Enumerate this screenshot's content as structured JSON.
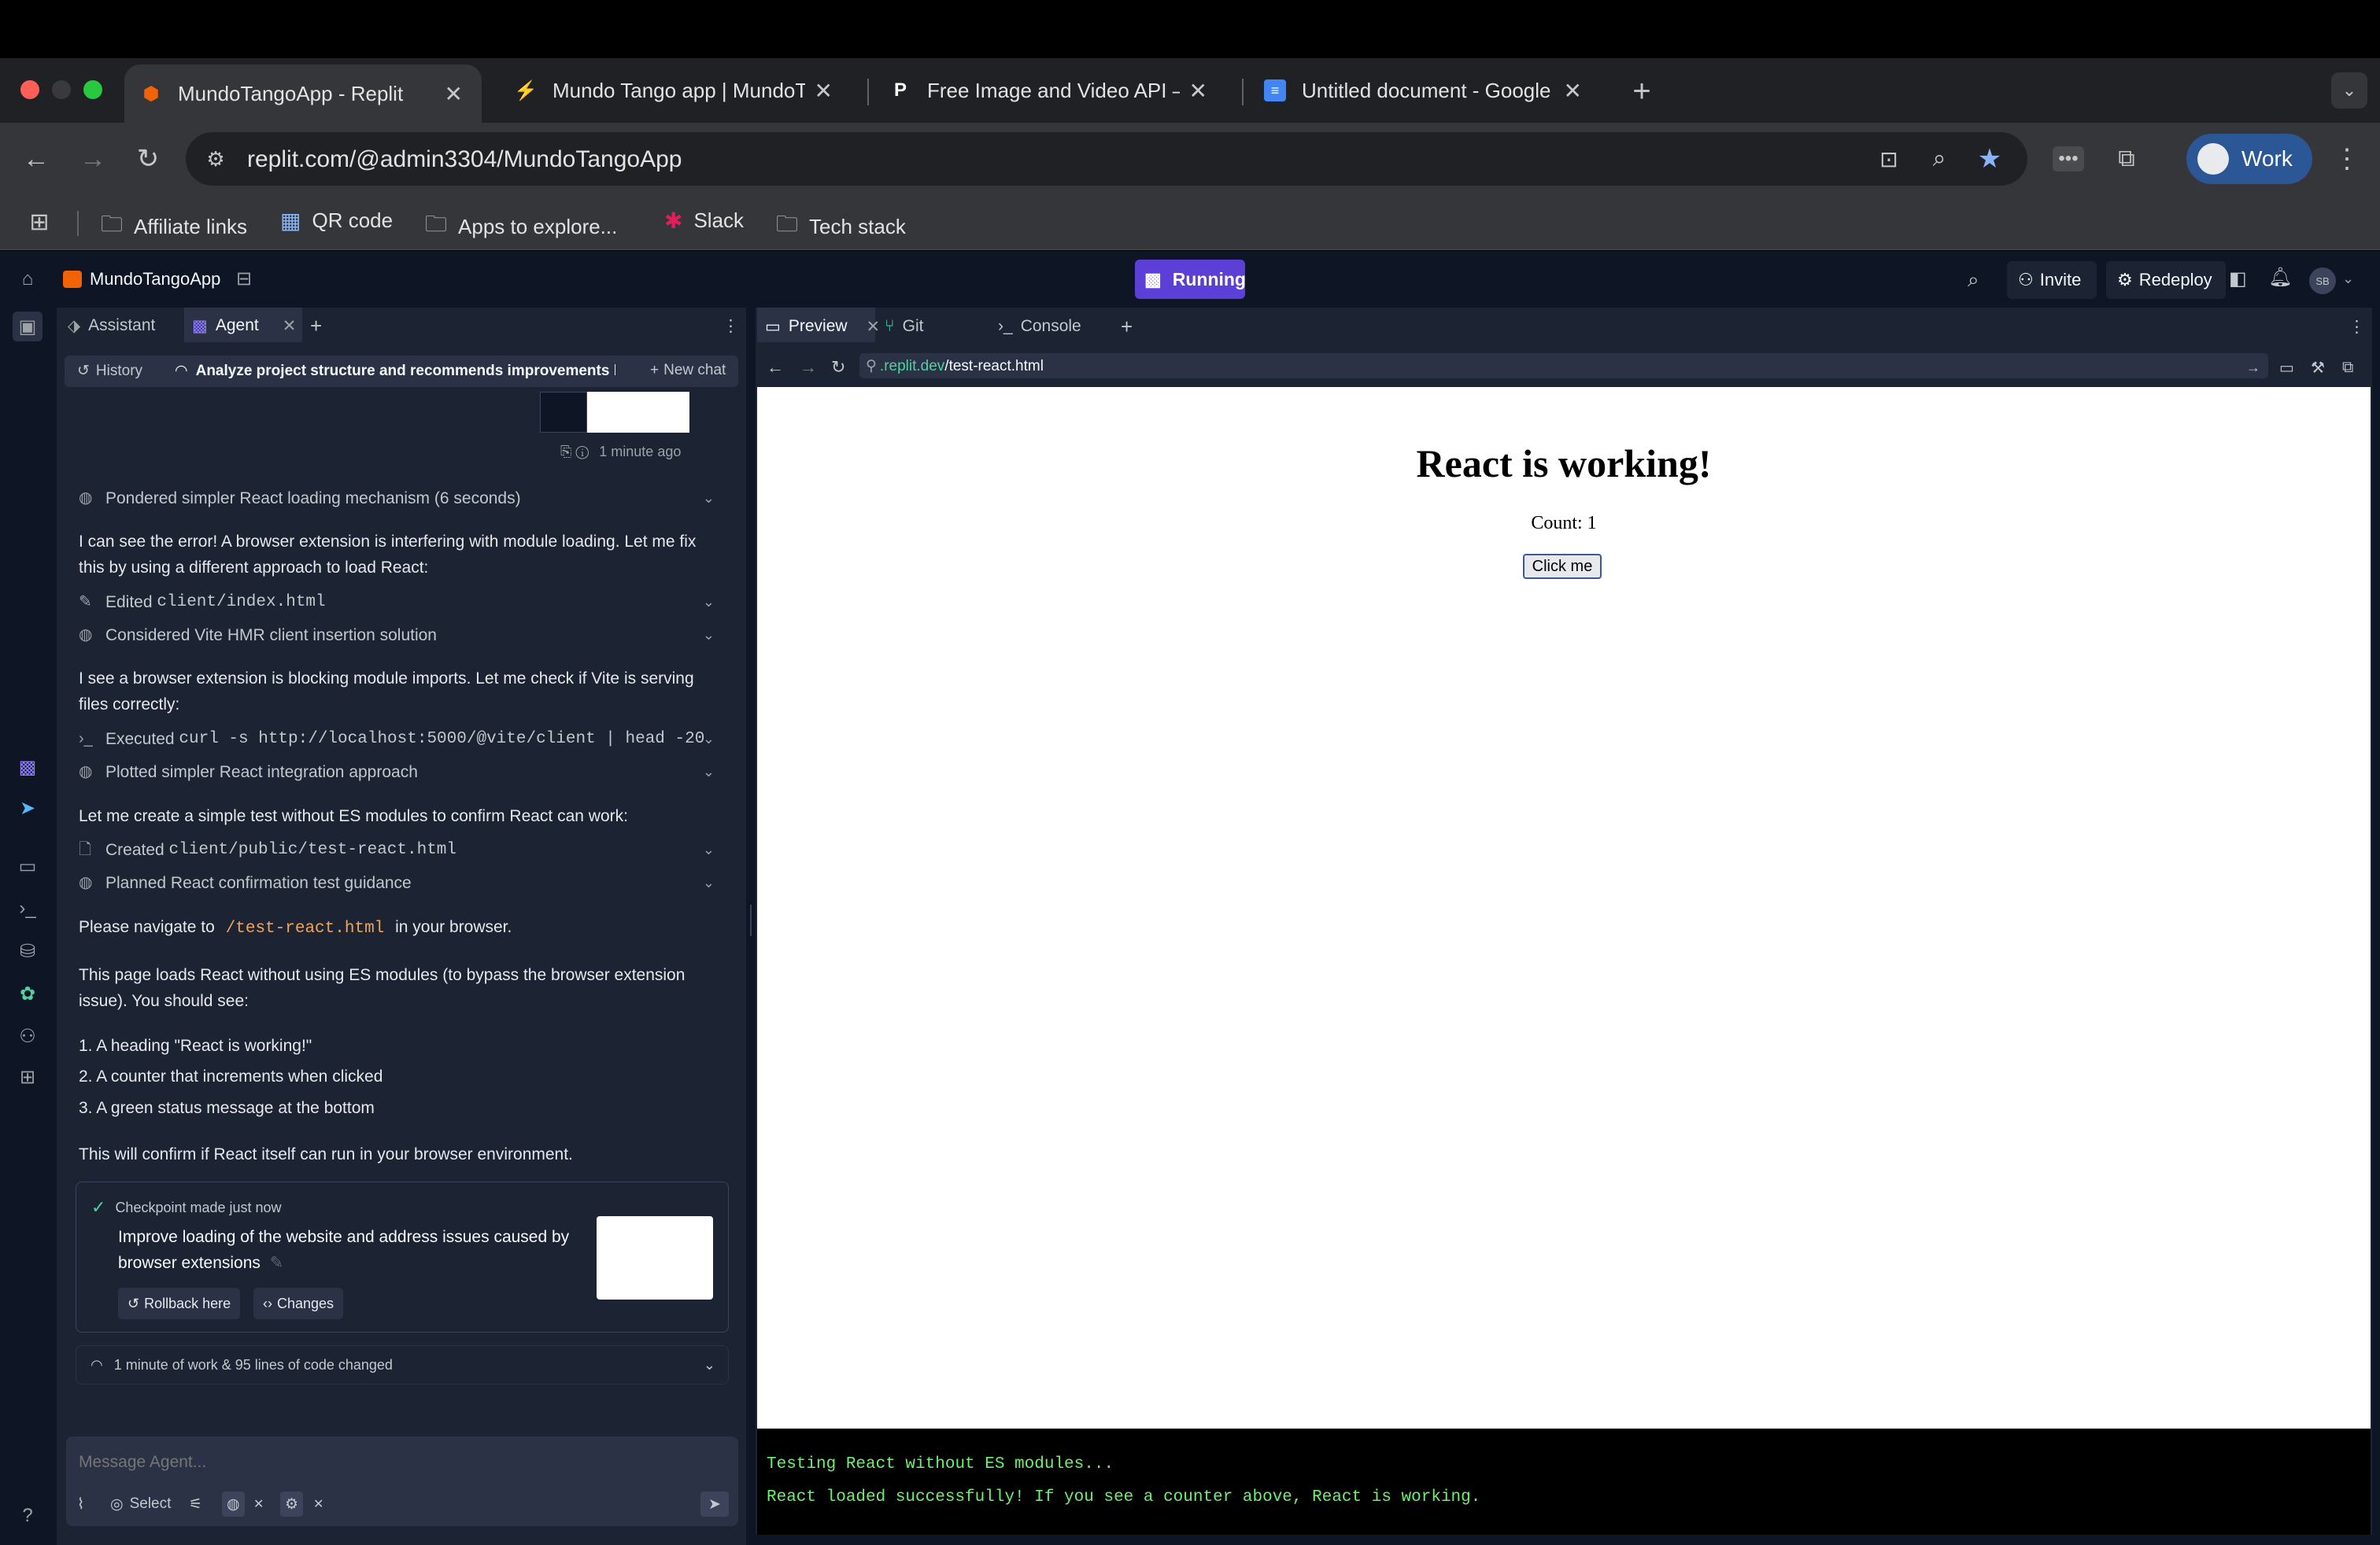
{
  "browser": {
    "tabs": [
      {
        "title": "MundoTangoApp - Replit",
        "icon": "replit-icon"
      },
      {
        "title": "Mundo Tango app | MundoTan",
        "icon": "bolt-icon"
      },
      {
        "title": "Free Image and Video API – P",
        "icon": "pexels-icon"
      },
      {
        "title": "Untitled document - Google D",
        "icon": "google-docs-icon"
      }
    ],
    "url": "replit.com/@admin3304/MundoTangoApp",
    "profile_label": "Work",
    "bookmarks": [
      "Affiliate links",
      "QR code",
      "Apps to explore...",
      "Slack",
      "Tech stack"
    ]
  },
  "app": {
    "project_name": "MundoTangoApp",
    "run_status": "Running",
    "invite_label": "Invite",
    "redeploy_label": "Redeploy",
    "avatar_initials": "SB"
  },
  "left_panel": {
    "tabs": [
      "Assistant",
      "Agent"
    ],
    "history_label": "History",
    "chat_title": "Analyze project structure and recommends improvements bas...",
    "new_chat_label": "New chat",
    "timestamp": "1 minute ago",
    "messages": [
      {
        "kind": "tool",
        "icon": "thought-icon",
        "text": "Pondered simpler React loading mechanism (6 seconds)"
      },
      {
        "kind": "text",
        "text": "I can see the error! A browser extension is interfering with module loading. Let me fix this by using a different approach to load React:"
      },
      {
        "kind": "tool",
        "icon": "edit-icon",
        "prefix": "Edited ",
        "code": "client/index.html"
      },
      {
        "kind": "tool",
        "icon": "thought-icon",
        "text": "Considered Vite HMR client insertion solution"
      },
      {
        "kind": "text",
        "text": "I see a browser extension is blocking module imports. Let me check if Vite is serving files correctly:"
      },
      {
        "kind": "tool",
        "icon": "terminal-icon",
        "prefix": "Executed ",
        "code": "curl -s http://localhost:5000/@vite/client | head -20"
      },
      {
        "kind": "tool",
        "icon": "thought-icon",
        "text": "Plotted simpler React integration approach"
      },
      {
        "kind": "text",
        "text": "Let me create a simple test without ES modules to confirm React can work:"
      },
      {
        "kind": "tool",
        "icon": "file-icon",
        "prefix": "Created ",
        "code": "client/public/test-react.html"
      },
      {
        "kind": "tool",
        "icon": "thought-icon",
        "text": "Planned React confirmation test guidance"
      }
    ],
    "navigate_prefix": "Please navigate to",
    "navigate_path": "/test-react.html",
    "navigate_suffix": "in your browser.",
    "explain": "This page loads React without using ES modules (to bypass the browser extension issue). You should see:",
    "list": [
      "1. A heading \"React is working!\"",
      "2. A counter that increments when clicked",
      "3. A green status message at the bottom"
    ],
    "confirm": "This will confirm if React itself can run in your browser environment.",
    "checkpoint": {
      "header": "Checkpoint made just now",
      "description": "Improve loading of the website and address issues caused by browser extensions",
      "rollback_label": "Rollback here",
      "changes_label": "Changes"
    },
    "work_summary": "1 minute of work & 95 lines of code changed",
    "message_placeholder": "Message Agent...",
    "select_label": "Select"
  },
  "right_panel": {
    "tabs": [
      "Preview",
      "Git",
      "Console"
    ],
    "preview_url_domain": ".replit.dev",
    "preview_url_path": "/test-react.html",
    "page": {
      "heading": "React is working!",
      "count_text": "Count: 1",
      "button_label": "Click me"
    },
    "status_lines": [
      "Testing React without ES modules...",
      "React loaded successfully! If you see a counter above, React is working."
    ]
  }
}
